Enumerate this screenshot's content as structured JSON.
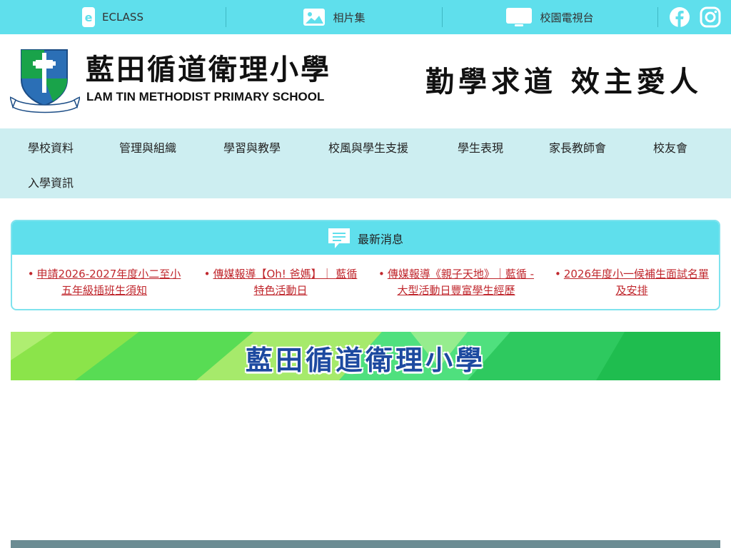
{
  "topbar": {
    "eclass_label": "ECLASS",
    "photos_label": "相片集",
    "tv_label": "校園電視台"
  },
  "header": {
    "school_name_cn": "藍田循道衛理小學",
    "school_name_en": "LAM TIN METHODIST PRIMARY SCHOOL",
    "motto": "勤學求道 效主愛人",
    "crest_text": "藍田循道衛理小學"
  },
  "nav": {
    "items": [
      "學校資料",
      "管理與組織",
      "學習與教學",
      "校風與學生支援",
      "學生表現",
      "家長教師會",
      "校友會",
      "入學資訊"
    ]
  },
  "news": {
    "title": "最新消息",
    "items": [
      "申請2026-2027年度小二至小五年級插班生須知",
      "傳媒報導【Oh! 爸媽】｜ 藍循特色活動日",
      "傳媒報導《親子天地》｜藍循 - 大型活動日豐富學生經歷",
      "2026年度小一候補生面試名單及安排"
    ]
  },
  "banner": {
    "text": "藍田循道衛理小學"
  },
  "colors": {
    "topbar": "#5fdfec",
    "nav": "#cdeef1",
    "news_link": "#c0272d"
  }
}
